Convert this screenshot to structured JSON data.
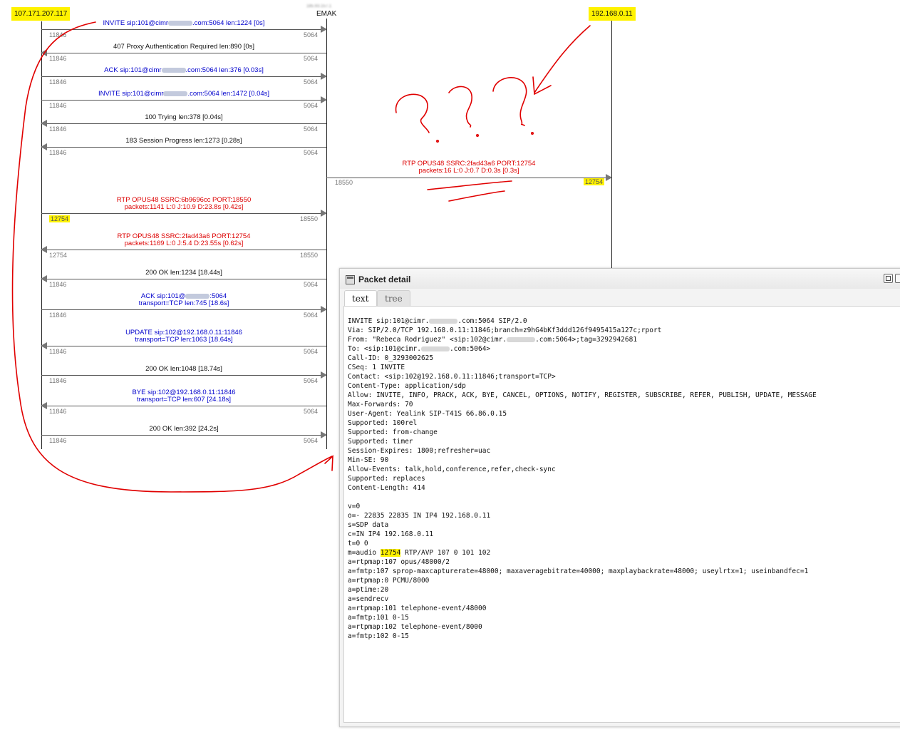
{
  "hosts": {
    "left": "107.171.207.117",
    "middle_ip_blurred": "185.93.157.1",
    "middle_name": "EMAK",
    "right": "192.168.0.11"
  },
  "messages": [
    {
      "label": "INVITE sip:101@cimr",
      "label_suffix": ".com:5064 len:1224 [0s]",
      "color": "blue",
      "dir": "right",
      "src_port": "11846",
      "dst_port": "5064"
    },
    {
      "label": "407 Proxy Authentication Required len:890 [0s]",
      "color": "black",
      "dir": "left",
      "src_port": "11846",
      "dst_port": "5064"
    },
    {
      "label": "ACK sip:101@cimr",
      "label_suffix": ".com:5064 len:376 [0.03s]",
      "color": "blue",
      "dir": "right",
      "src_port": "11846",
      "dst_port": "5064"
    },
    {
      "label": "INVITE sip:101@cimr",
      "label_suffix": ".com:5064 len:1472 [0.04s]",
      "color": "blue",
      "dir": "right",
      "src_port": "11846",
      "dst_port": "5064"
    },
    {
      "label": "100 Trying len:378 [0.04s]",
      "color": "black",
      "dir": "left",
      "src_port": "11846",
      "dst_port": "5064"
    },
    {
      "label": "183 Session Progress len:1273 [0.28s]",
      "color": "black",
      "dir": "left",
      "src_port": "11846",
      "dst_port": "5064"
    },
    {
      "label": "RTP OPUS48 SSRC:6b9696cc PORT:18550",
      "label2": "packets:1141 L:0 J:10.9 D:23.8s [0.42s]",
      "color": "red",
      "dir": "right",
      "src_port": "12754",
      "dst_port": "18550"
    },
    {
      "label": "RTP OPUS48 SSRC:2fad43a6 PORT:12754",
      "label2": "packets:1169 L:0 J:5.4 D:23.55s [0.62s]",
      "color": "red",
      "dir": "left",
      "src_port": "12754",
      "dst_port": "18550"
    },
    {
      "label": "200 OK len:1234 [18.44s]",
      "color": "black",
      "dir": "left",
      "src_port": "11846",
      "dst_port": "5064"
    },
    {
      "label": "ACK sip:101@",
      "label_suffix": ":5064",
      "label2": "transport=TCP len:745 [18.6s]",
      "color": "blue",
      "dir": "right",
      "src_port": "11846",
      "dst_port": "5064"
    },
    {
      "label": "UPDATE sip:102@192.168.0.11:11846",
      "label2": "transport=TCP len:1063 [18.64s]",
      "color": "blue",
      "dir": "left",
      "src_port": "11846",
      "dst_port": "5064"
    },
    {
      "label": "200 OK len:1048 [18.74s]",
      "color": "black",
      "dir": "right",
      "src_port": "11846",
      "dst_port": "5064"
    },
    {
      "label": "BYE sip:102@192.168.0.11:11846",
      "label2": "transport=TCP len:607 [24.18s]",
      "color": "blue",
      "dir": "left",
      "src_port": "11846",
      "dst_port": "5064"
    },
    {
      "label": "200 OK len:392 [24.2s]",
      "color": "black",
      "dir": "right",
      "src_port": "11846",
      "dst_port": "5064"
    }
  ],
  "rtp_right": {
    "label": "RTP OPUS48 SSRC:2fad43a6 PORT:12754",
    "label2": "packets:16 L:0 J:0.7 D:0.3s [0.3s]",
    "src_port": "18550",
    "dst_port": "12754"
  },
  "panel": {
    "title": "Packet detail",
    "tabs": [
      "text",
      "tree"
    ],
    "highlight": "12754",
    "lines": [
      "INVITE sip:101@cimr.{B}.com:5064 SIP/2.0",
      "Via: SIP/2.0/TCP 192.168.0.11:11846;branch=z9hG4bKf3ddd126f9495415a127c;rport",
      "From: \"Rebeca Rodriguez\" <sip:102@cimr.{B}.com:5064>;tag=3292942681",
      "To: <sip:101@cimr.{B}.com:5064>",
      "Call-ID: 0_3293002625",
      "CSeq: 1 INVITE",
      "Contact: <sip:102@192.168.0.11:11846;transport=TCP>",
      "Content-Type: application/sdp",
      "Allow: INVITE, INFO, PRACK, ACK, BYE, CANCEL, OPTIONS, NOTIFY, REGISTER, SUBSCRIBE, REFER, PUBLISH, UPDATE, MESSAGE",
      "Max-Forwards: 70",
      "User-Agent: Yealink SIP-T41S 66.86.0.15",
      "Supported: 100rel",
      "Supported: from-change",
      "Supported: timer",
      "Session-Expires: 1800;refresher=uac",
      "Min-SE: 90",
      "Allow-Events: talk,hold,conference,refer,check-sync",
      "Supported: replaces",
      "Content-Length: 414",
      "",
      "v=0",
      "o=- 22835 22835 IN IP4 192.168.0.11",
      "s=SDP data",
      "c=IN IP4 192.168.0.11",
      "t=0 0",
      "m=audio {H} RTP/AVP 107 0 101 102",
      "a=rtpmap:107 opus/48000/2",
      "a=fmtp:107 sprop-maxcapturerate=48000; maxaveragebitrate=40000; maxplaybackrate=48000; useylrtx=1; useinbandfec=1",
      "a=rtpmap:0 PCMU/8000",
      "a=ptime:20",
      "a=sendrecv",
      "a=rtpmap:101 telephone-event/48000",
      "a=fmtp:101 0-15",
      "a=rtpmap:102 telephone-event/8000",
      "a=fmtp:102 0-15"
    ]
  }
}
